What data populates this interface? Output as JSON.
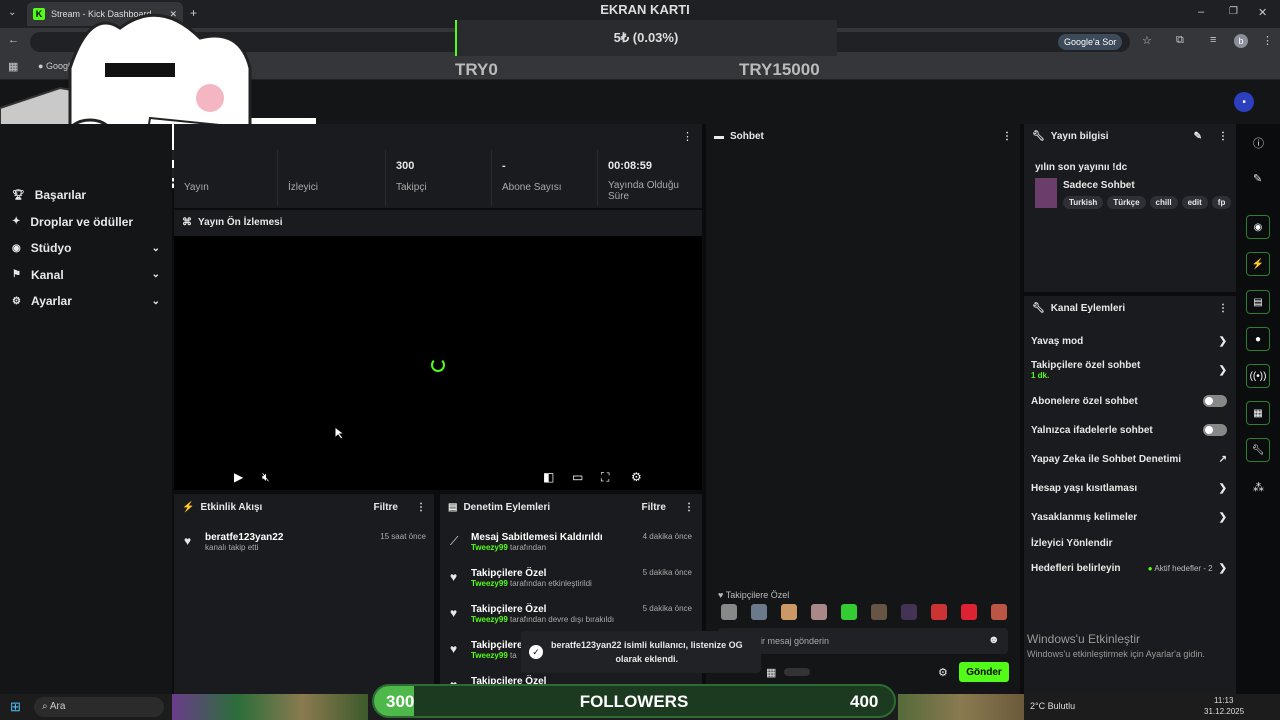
{
  "browser": {
    "tab_title": "Stream - Kick Dashboard",
    "url_partial": "am",
    "bookmark_google": "Google",
    "ask_google": "Google'a Sor",
    "profile_letter": "b"
  },
  "overlay": {
    "title": "EKRAN KARTI",
    "progress_text": "5₺ (0.03%)",
    "progress_fraction": 0.0003,
    "min_label": "TRY0",
    "max_label": "TRY15000"
  },
  "sidebar": {
    "items": [
      {
        "label": "Başarılar",
        "icon": "trophy-icon",
        "chevron": false
      },
      {
        "label": "Droplar ve ödüller",
        "icon": "gift-icon",
        "chevron": false
      },
      {
        "label": "Stüdyo",
        "icon": "studio-icon",
        "chevron": true
      },
      {
        "label": "Kanal",
        "icon": "channel-icon",
        "chevron": true
      },
      {
        "label": "Ayarlar",
        "icon": "gear-icon",
        "chevron": true
      }
    ]
  },
  "stats": {
    "col1_label": "Yayın",
    "col2_label": "İzleyici",
    "followers_value": "300",
    "followers_label": "Takipçi",
    "subs_value": "-",
    "subs_label": "Abone Sayısı",
    "uptime_value": "00:08:59",
    "uptime_label": "Yayında Olduğu Süre"
  },
  "preview": {
    "title": "Yayın Ön İzlemesi"
  },
  "activity": {
    "title": "Etkinlik Akışı",
    "filter": "Filtre",
    "items": [
      {
        "name": "beratfe123yan22",
        "sub": "kanalı takip etti",
        "time": "15 saat önce"
      }
    ]
  },
  "moderation": {
    "title": "Denetim Eylemleri",
    "filter": "Filtre",
    "items": [
      {
        "title": "Mesaj Sabitlemesi Kaldırıldı",
        "user": "Tweezy99",
        "sub": "tarafından",
        "time": "4 dakika önce"
      },
      {
        "title": "Takipçilere Özel",
        "user": "Tweezy99",
        "sub": "tarafından etkinleştirildi",
        "time": "5 dakika önce"
      },
      {
        "title": "Takipçilere Özel",
        "user": "Tweezy99",
        "sub": "tarafından devre dışı bırakıldı",
        "time": "5 dakika önce"
      },
      {
        "title": "Takipçilere",
        "user": "Tweezy99",
        "sub": "ta",
        "time": ""
      },
      {
        "title": "Takipçilere Özel",
        "user": "",
        "sub": "",
        "time": ""
      }
    ]
  },
  "chat": {
    "title": "Sohbet",
    "followers_only": "Takipçilere Özel",
    "placeholder": "ir mesaj gönderin",
    "send": "Gönder"
  },
  "toast": {
    "line1": "beratfe123yan22 isimli kullanıcı, listenize OG",
    "line2": "olarak eklendi."
  },
  "stream_info": {
    "title": "Yayın bilgisi",
    "stream_title": "yılın son yayınıı !dc",
    "category": "Sadece Sohbet",
    "tags": [
      "Turkish",
      "Türkçe",
      "chill",
      "edit",
      "fp"
    ]
  },
  "channel_actions": {
    "title": "Kanal Eylemleri",
    "slow_mode": "Yavaş mod",
    "followers_chat": "Takipçilere özel sohbet",
    "followers_chat_sub": "1 dk.",
    "subs_chat": "Abonelere özel sohbet",
    "emote_chat": "Yalnızca ifadelerle sohbet",
    "ai_mod": "Yapay Zeka ile Sohbet Denetimi",
    "account_age": "Hesap yaşı kısıtlaması",
    "banned_words": "Yasaklanmış kelimeler",
    "redirect": "İzleyici Yönlendir",
    "goals": "Hedefleri belirleyin",
    "goals_status": "Aktif hedefler - 2"
  },
  "windows_watermark": {
    "title": "Windows'u Etkinleştir",
    "sub": "Windows'u etkinleştirmek için Ayarlar'a gidin."
  },
  "followers_bar": {
    "left": "300",
    "center": "FOLLOWERS",
    "right": "400"
  },
  "taskbar": {
    "search": "Ara",
    "weather": "2°C  Bulutlu",
    "time": "11:13",
    "date": "31.12.2025"
  },
  "colors": {
    "accent": "#53fc18",
    "panel": "#1a1b1e",
    "bg": "#0b0c0d"
  }
}
